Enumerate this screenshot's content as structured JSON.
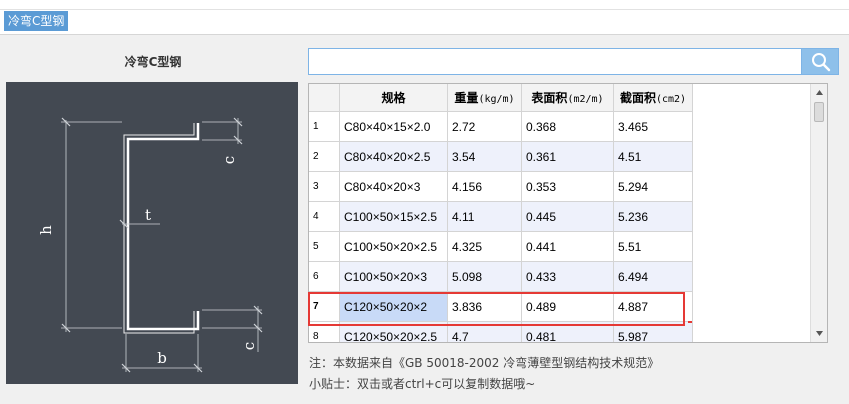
{
  "top_tab": "冷弯C型钢",
  "section_title": "冷弯C型钢",
  "search": {
    "value": "",
    "placeholder": ""
  },
  "diagram_labels": {
    "h": "h",
    "b": "b",
    "c_top": "c",
    "c_bottom": "c",
    "t": "t"
  },
  "table": {
    "headers": [
      "规格",
      "重量",
      "表面积",
      "截面积"
    ],
    "header_units": [
      "",
      "(kg/m)",
      "(m2/m)",
      "(cm2)"
    ],
    "rows": [
      {
        "num": "1",
        "spec": "C80×40×15×2.0",
        "weight": "2.72",
        "surface": "0.368",
        "section": "3.465"
      },
      {
        "num": "2",
        "spec": "C80×40×20×2.5",
        "weight": "3.54",
        "surface": "0.361",
        "section": "4.51"
      },
      {
        "num": "3",
        "spec": "C80×40×20×3",
        "weight": "4.156",
        "surface": "0.353",
        "section": "5.294"
      },
      {
        "num": "4",
        "spec": "C100×50×15×2.5",
        "weight": "4.11",
        "surface": "0.445",
        "section": "5.236"
      },
      {
        "num": "5",
        "spec": "C100×50×20×2.5",
        "weight": "4.325",
        "surface": "0.441",
        "section": "5.51"
      },
      {
        "num": "6",
        "spec": "C100×50×20×3",
        "weight": "5.098",
        "surface": "0.433",
        "section": "6.494"
      },
      {
        "num": "7",
        "spec": "C120×50×20×2",
        "weight": "3.836",
        "surface": "0.489",
        "section": "4.887"
      },
      {
        "num": "8",
        "spec": "C120×50×20×2.5",
        "weight": "4.7",
        "surface": "0.481",
        "section": "5.987"
      }
    ]
  },
  "note": "注：本数据来自《GB  50018-2002  冷弯薄壁型钢结构技术规范》",
  "tip": "小贴士：双击或者ctrl+c可以复制数据哦~",
  "colors": {
    "accent": "#5b9bd5",
    "highlight": "#e53935",
    "diagram_bg": "#434952"
  }
}
